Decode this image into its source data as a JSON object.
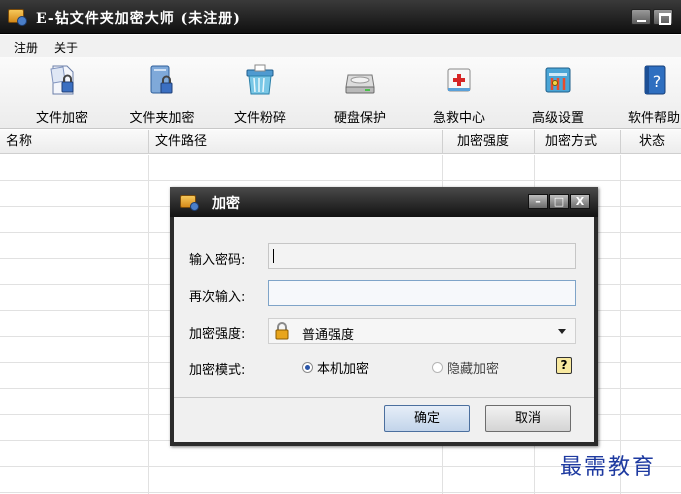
{
  "window": {
    "title": "E-钻文件夹加密大师 (未注册)"
  },
  "menu": {
    "items": [
      "注册",
      "关于"
    ]
  },
  "toolbar": {
    "items": [
      {
        "label": "文件加密",
        "icon": "file-lock-icon"
      },
      {
        "label": "文件夹加密",
        "icon": "folder-lock-icon"
      },
      {
        "label": "文件粉碎",
        "icon": "shredder-icon"
      },
      {
        "label": "硬盘保护",
        "icon": "hard-disk-icon"
      },
      {
        "label": "急救中心",
        "icon": "first-aid-icon"
      },
      {
        "label": "高级设置",
        "icon": "advanced-settings-icon"
      },
      {
        "label": "软件帮助",
        "icon": "help-book-icon"
      }
    ]
  },
  "table": {
    "columns": [
      "名称",
      "文件路径",
      "加密强度",
      "加密方式",
      "状态"
    ],
    "rows": []
  },
  "dialog": {
    "title": "加密",
    "password_label": "输入密码:",
    "password_value": "",
    "confirm_label": "再次输入:",
    "confirm_value": "",
    "strength_label": "加密强度:",
    "strength_value": "普通强度",
    "mode_label": "加密模式:",
    "mode_options": [
      "本机加密",
      "隐藏加密"
    ],
    "mode_selected": "本机加密",
    "help_glyph": "?",
    "ok_label": "确定",
    "cancel_label": "取消",
    "close_glyph": "X"
  },
  "watermark": "最需教育"
}
